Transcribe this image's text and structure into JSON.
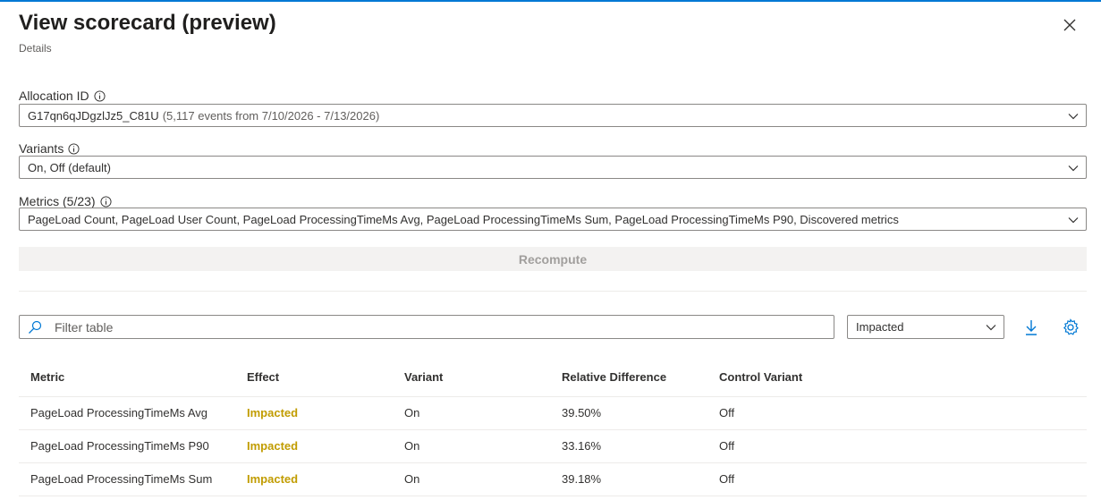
{
  "header": {
    "title": "View scorecard (preview)",
    "subtitle": "Details"
  },
  "colors": {
    "accent": "#0078d4",
    "impacted": "#c19c00"
  },
  "allocation": {
    "label": "Allocation ID",
    "value": "G17qn6qJDgzlJz5_C81U",
    "detail": "(5,117 events from 7/10/2026 - 7/13/2026)"
  },
  "variants": {
    "label": "Variants",
    "value": "On, Off (default)"
  },
  "metrics": {
    "label": "Metrics (5/23)",
    "value": "PageLoad Count, PageLoad User Count, PageLoad ProcessingTimeMs Avg, PageLoad ProcessingTimeMs Sum, PageLoad ProcessingTimeMs P90, Discovered metrics"
  },
  "recompute_label": "Recompute",
  "filter": {
    "placeholder": "Filter table"
  },
  "effect_filter": {
    "value": "Impacted"
  },
  "table": {
    "columns": [
      "Metric",
      "Effect",
      "Variant",
      "Relative Difference",
      "Control Variant"
    ],
    "rows": [
      [
        "PageLoad ProcessingTimeMs Avg",
        "Impacted",
        "On",
        "39.50%",
        "Off"
      ],
      [
        "PageLoad ProcessingTimeMs P90",
        "Impacted",
        "On",
        "33.16%",
        "Off"
      ],
      [
        "PageLoad ProcessingTimeMs Sum",
        "Impacted",
        "On",
        "39.18%",
        "Off"
      ]
    ]
  }
}
